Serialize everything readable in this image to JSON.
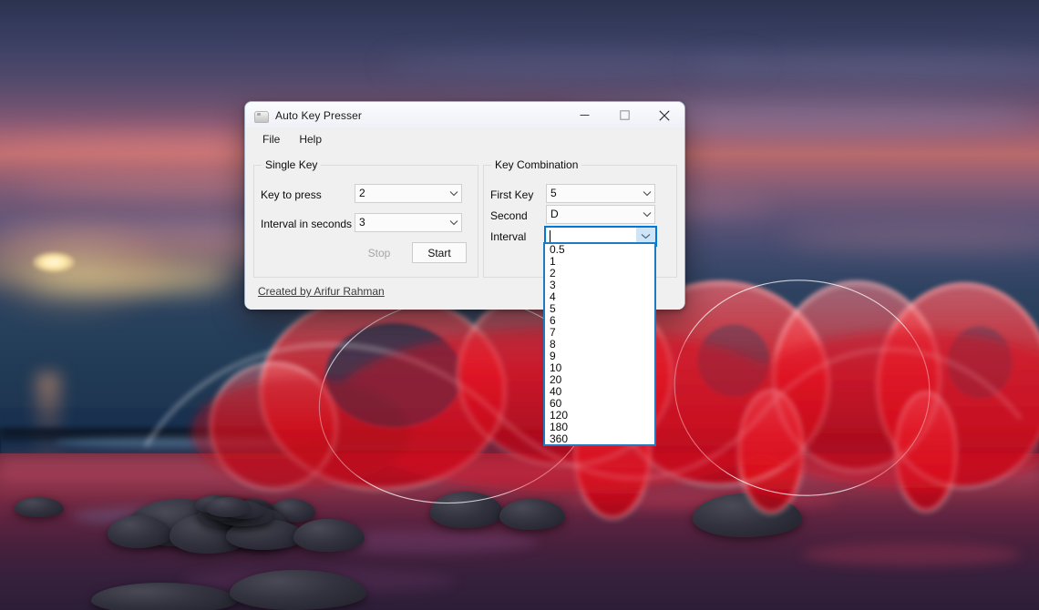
{
  "desktop": {
    "wallpaper_description": "sunset beach with red light-painting spirals",
    "colors": {
      "sky_top": "#2b3350",
      "sky_sunset": "#b96a6b",
      "sea": "#1a3250",
      "sand": "#7a2c42",
      "light_red": "#ec1c24",
      "light_white": "#ffffff"
    }
  },
  "window": {
    "title": "Auto Key Presser",
    "icon": "app-icon",
    "controls": {
      "minimize": "minimize-icon",
      "maximize": "maximize-icon",
      "close": "close-icon"
    },
    "menu": [
      "File",
      "Help"
    ],
    "single_key": {
      "legend": "Single Key",
      "key_label": "Key to press",
      "key_value": "2",
      "interval_label": "Interval in seconds",
      "interval_value": "3",
      "stop_button": "Stop",
      "stop_enabled": false,
      "start_button": "Start",
      "start_enabled": true
    },
    "key_combination": {
      "legend": "Key Combination",
      "first_key_label": "First Key",
      "first_key_value": "5",
      "second_label": "Second",
      "second_value": "D",
      "interval_label": "Interval",
      "interval_value": "",
      "interval_focused": true
    },
    "credit": "Created by Arifur Rahman",
    "dropdown": {
      "open": true,
      "owner": "key-combination-interval",
      "options": [
        "0.5",
        "1",
        "2",
        "3",
        "4",
        "5",
        "6",
        "7",
        "8",
        "9",
        "10",
        "20",
        "40",
        "60",
        "120",
        "180",
        "360"
      ],
      "selected": "",
      "border_color": "#1f7bc1"
    },
    "accent_color": "#0078d7"
  }
}
